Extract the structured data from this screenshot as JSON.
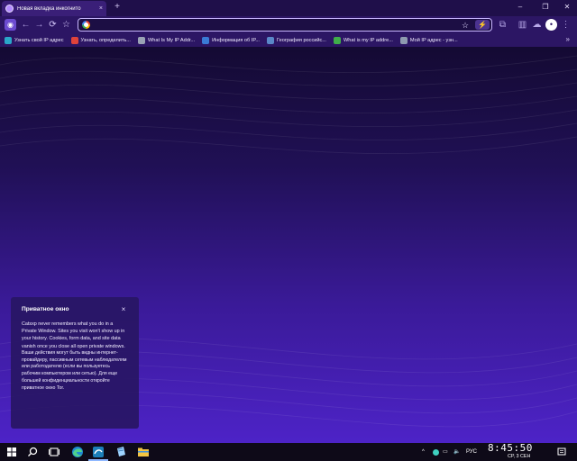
{
  "browser": {
    "tab": {
      "title": "Новая вкладка инкогнито",
      "close_glyph": "×"
    },
    "new_tab_glyph": "+",
    "window_controls": {
      "minimize": "–",
      "restore": "❐",
      "close": "✕"
    },
    "toolbar": {
      "back_glyph": "←",
      "forward_glyph": "→",
      "reload_glyph": "⟳",
      "star_glyph": "☆",
      "address_value": "",
      "address_placeholder": ""
    },
    "bookmarks": [
      {
        "label": "Узнать свой IP адрес",
        "color": "#2aa7c9"
      },
      {
        "label": "Узнать, определить...",
        "color": "#e0433a"
      },
      {
        "label": "What Is My IP Addr...",
        "color": "#9aa3b5"
      },
      {
        "label": "Информация об IP...",
        "color": "#3a7bd5"
      },
      {
        "label": "География российс...",
        "color": "#5a88c8"
      },
      {
        "label": "What is my IP addre...",
        "color": "#3fae4a"
      },
      {
        "label": "Мой IP адрес - узн...",
        "color": "#8e9ab0"
      }
    ],
    "bookmarks_more": "»"
  },
  "private_panel": {
    "title": "Приватное окно",
    "close_glyph": "×",
    "text_en": "Catsxp never remembers what you do in a Private Window. Sites you visit won't show up in your history. Cookies, form data, and site data vanish once you close all open private windows.",
    "text_ru": "Ваши действия могут быть видны интернет-провайдеру, пассивным сетевым наблюдателям или работодателю (если вы пользуетесь рабочим компьютером или сетью). Для еще большей конфиденциальности откройте приватное окно Tor."
  },
  "taskbar": {
    "tray_arrow": "^",
    "lang": "РУС",
    "time": "8:45:50",
    "date": "СР, 3 СЕН"
  },
  "colors": {
    "accent": "#c9b8ff",
    "content_bottom": "#4d23c7",
    "content_top": "#140a33"
  }
}
